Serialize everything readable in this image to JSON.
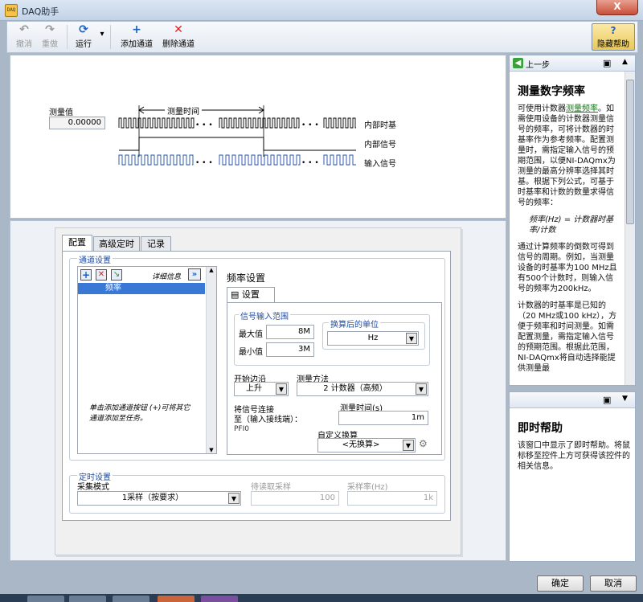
{
  "window": {
    "title": "DAQ助手",
    "close_label": "X",
    "icon_text": "DAQ"
  },
  "toolbar": {
    "undo": "撤消",
    "redo": "重做",
    "run": "运行",
    "add_channel": "添加通道",
    "delete_channel": "删除通道",
    "hide_help": "隐藏帮助"
  },
  "diagram": {
    "measured_value_label": "测量值",
    "measured_value": "0.00000",
    "measure_time_label": "测量时间",
    "internal_timebase": "内部时基",
    "internal_signal": "内部信号",
    "input_signal": "输入信号"
  },
  "tabs": [
    "配置",
    "高级定时",
    "记录"
  ],
  "channel_settings": {
    "title": "通道设置",
    "details_label": "详细信息",
    "channels": [
      "频率"
    ],
    "hint": "单击添加通道按钮 (+)可将其它通道添加至任务。"
  },
  "freq_settings": {
    "title": "频率设置",
    "subtab": "设置",
    "signal_range_title": "信号输入范围",
    "max_label": "最大值",
    "max_value": "8M",
    "min_label": "最小值",
    "min_value": "3M",
    "scaled_units_title": "换算后的单位",
    "units_value": "Hz",
    "starting_edge_label": "开始边沿",
    "starting_edge_value": "上升",
    "method_label": "测量方法",
    "method_value": "2 计数器（高频）",
    "connect_label_1": "将信号连接",
    "connect_label_2": "至（输入接线端）：",
    "terminal": "PFI0",
    "measure_time_label": "测量时间(s)",
    "measure_time_value": "1m",
    "custom_scale_label": "自定义换算",
    "custom_scale_value": "<无换算>"
  },
  "timing": {
    "title": "定时设置",
    "mode_label": "采集模式",
    "mode_value": "1采样（按要求）",
    "samples_label": "待读取采样",
    "samples_value": "100",
    "rate_label": "采样率(Hz)",
    "rate_value": "1k"
  },
  "help": {
    "back_label": "上一步",
    "title": "测量数字频率",
    "p1_pre": "可使用计数器",
    "p1_link": "测量频率",
    "p1_post": "。如需使用设备的计数器测量信号的频率，可将计数器的时基率作为参考频率。配置测量时，需指定输入信号的预期范围，以便NI-DAQmx为测量的最高分辨率选择其时基。根据下列公式，可基于时基率和计数的数量求得信号的频率：",
    "formula": "频率(Hz) = 计数器时基率/计数",
    "p2": "通过计算频率的倒数可得到信号的周期。例如，当测量设备的时基率为100 MHz且有500个计数时，则输入信号的频率为200kHz。",
    "p3": "计数器的时基率是已知的（20 MHz或100 kHz），方便于频率和时间测量。如需配置测量，需指定输入信号的预期范围。根据此范围，NI-DAQmx将自动选择能提供测量最",
    "context_title": "即时帮助",
    "context_text": "该窗口中显示了即时帮助。将鼠标移至控件上方可获得该控件的相关信息。"
  },
  "footer": {
    "ok": "确定",
    "cancel": "取消"
  }
}
